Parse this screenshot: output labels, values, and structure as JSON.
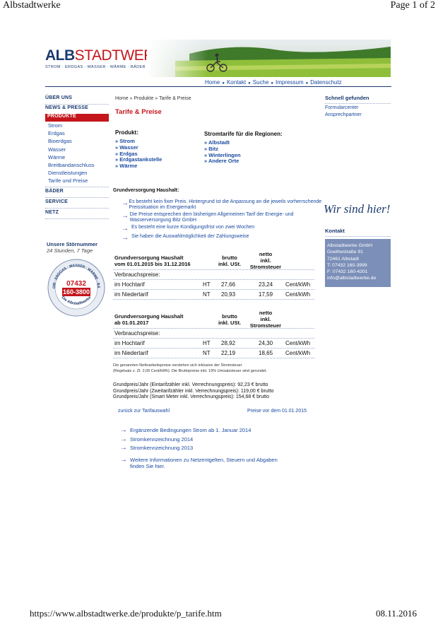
{
  "print_header": {
    "title": "Albstadtwerke",
    "page": "Page 1 of 2"
  },
  "print_footer": {
    "url": "https://www.albstadtwerke.de/produkte/p_tarife.htm",
    "date": "08.11.2016"
  },
  "logo": {
    "name_part1": "ALB",
    "name_part2": "STADTWERKE",
    "tagline": "STROM · ERDGAS · WASSER · WÄRME · BÄDER"
  },
  "top_nav": [
    "Home",
    "Kontakt",
    "Suche",
    "Impressum",
    "Datenschutz"
  ],
  "left_nav": {
    "sections": [
      "ÜBER UNS",
      "NEWS & PRESSE",
      "PRODUKTE"
    ],
    "products": [
      "Strom",
      "Erdgas",
      "Bioerdgas",
      "Wasser",
      "Wärme",
      "Breitbandanschluss",
      "Dienstleistungen",
      "Tarife und Preise"
    ],
    "more_sections": [
      "BÄDER",
      "SERVICE",
      "NETZ"
    ],
    "stoer": {
      "title": "Unsere Störnummer",
      "subtitle": "24 Stunden, 7 Tage",
      "badge_top": "STROM · ERDGAS · WASSER · WÄRME · BÄDER",
      "number1": "07432",
      "number2": "160-3800",
      "badge_bottom": "Die Albstadtwerke"
    }
  },
  "breadcrumb": "Home » Produkte » Tarife & Preise",
  "page_title": "Tarife & Preise",
  "produkt": {
    "label": "Produkt:",
    "items": [
      "» Strom",
      "» Wasser",
      "» Erdgas",
      "» Erdgastankstelle",
      "» Wärme"
    ]
  },
  "regionen": {
    "label": "Stromtarife für die Regionen:",
    "items": [
      "» Albstadt",
      "» Bitz",
      "» Winterlingen",
      "» Andere Orte"
    ]
  },
  "grundversorgung": {
    "heading": "Grundversorgung Haushalt:",
    "bullets": [
      "Es besteht kein fixer Preis. Hintergrund ist die Anpassung an die jeweils vorherrschende Preissituation im Energiemarkt",
      "Die Preise entsprechen dem bisherigen Allgemeinen Tarif der Energie- und Wasserversorgung Bitz GmbH",
      "Es besteht eine kurze Kündigungsfrist von zwei Wochen",
      "Sie haben die Auswahlmöglichkeit der Zahlungsweise"
    ]
  },
  "table1": {
    "title_line1": "Grundversorgung Haushalt",
    "title_line2": "vom 01.01.2015 bis 31.12.2016",
    "col_brutto1": "brutto",
    "col_brutto2": "inkl. USt.",
    "col_netto1": "netto",
    "col_netto2": "inkl.",
    "col_netto3": "Stromsteuer",
    "subheader": "Verbrauchspreise:",
    "rows": [
      {
        "label": "im Hochtarif",
        "code": "HT",
        "brutto": "27,66",
        "netto": "23,24",
        "unit": "Cent/kWh"
      },
      {
        "label": "im Niedertarif",
        "code": "NT",
        "brutto": "20,93",
        "netto": "17,59",
        "unit": "Cent/kWh"
      }
    ]
  },
  "table2": {
    "title_line1": "Grundversorgung Haushalt",
    "title_line2": "ab 01.01.2017",
    "col_brutto1": "brutto",
    "col_brutto2": "inkl. USt.",
    "col_netto1": "netto",
    "col_netto2": "inkl.",
    "col_netto3": "Stromsteuer",
    "subheader": "Verbrauchspreise:",
    "rows": [
      {
        "label": "im Hochtarif",
        "code": "HT",
        "brutto": "28,92",
        "netto": "24,30",
        "unit": "Cent/kWh"
      },
      {
        "label": "im Niedertarif",
        "code": "NT",
        "brutto": "22,19",
        "netto": "18,65",
        "unit": "Cent/kWh"
      }
    ]
  },
  "footnote": {
    "line1": "Die genannten Nettoarbeitspreise verstehen sich inklusive der Stromsteuer",
    "line2": "(Regelsatz z. Zt. 2,05 Cent/kWh). Die Bruttopreise inkl. 19% Umsatzsteuer sind gerundet."
  },
  "grundpreise": [
    "Grundpreis/Jahr (Eintarifzähler inkl. Verrechnungspreis): 92,23 € brutto",
    "Grundpreis/Jahr (Zweitarifzähler inkl. Verrechnungspreis): 119,00 € brutto",
    "Grundpreis/Jahr (Smart Meter inkl. Verrechnungspreis): 154,68 € brutto"
  ],
  "links_row": {
    "back": "zurück zur Tarifauswahl",
    "prev": "Preise vor dem 01.01.2015"
  },
  "doc_links": [
    "Ergänzende Bedingungen Strom ab 1. Januar 2014",
    "Stromkennzeichnung 2014",
    "Stromkennzeichnung 2013"
  ],
  "more_info": {
    "line1": "Weitere Informationen zu Netzentgelten, Steuern und Abgaben",
    "line2": "finden Sie hier."
  },
  "right": {
    "schnell_title": "Schnell gefunden",
    "schnell_links": [
      "Formularcenter",
      "Ansprechpartner"
    ],
    "slogan": "Wir sind hier!",
    "kontakt_title": "Kontakt",
    "kontakt_lines": [
      "Albstadtwerke GmbH",
      "Goethestraße 91",
      "72461 Albstadt",
      "T: 07432 160-3999",
      "F: 07432 160-4201",
      "info@albstadtwerke.de"
    ]
  }
}
